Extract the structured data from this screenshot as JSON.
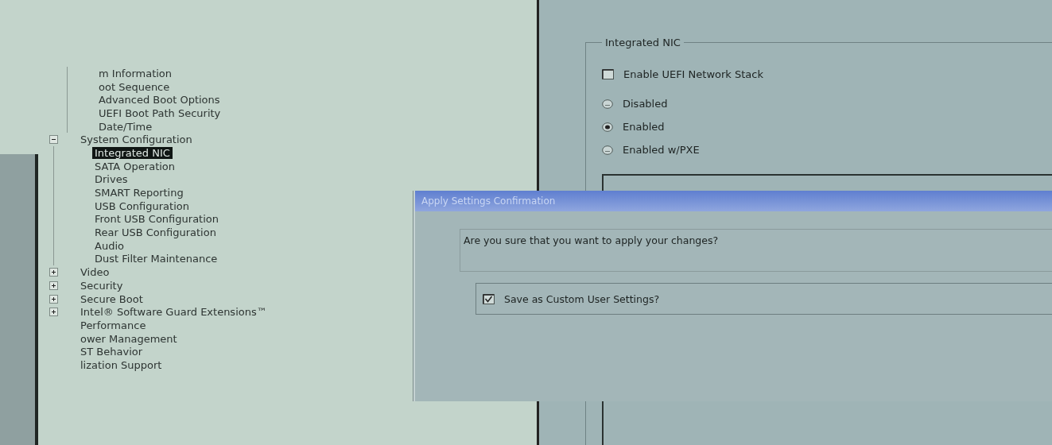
{
  "tree": [
    {
      "children": [
        {
          "label": "m Information",
          "selected": false
        },
        {
          "label": "oot Sequence",
          "selected": false
        },
        {
          "label": "Advanced Boot Options",
          "selected": false
        },
        {
          "label": "UEFI Boot Path Security",
          "selected": false
        },
        {
          "label": "Date/Time",
          "selected": false
        }
      ]
    },
    {
      "label": "System Configuration",
      "selected": false,
      "expanded": true,
      "children": [
        {
          "label": "Integrated NIC",
          "selected": true
        },
        {
          "label": "SATA Operation",
          "selected": false
        },
        {
          "label": "Drives",
          "selected": false
        },
        {
          "label": "SMART Reporting",
          "selected": false
        },
        {
          "label": "USB Configuration",
          "selected": false
        },
        {
          "label": "Front USB Configuration",
          "selected": false
        },
        {
          "label": "Rear USB Configuration",
          "selected": false
        },
        {
          "label": "Audio",
          "selected": false
        },
        {
          "label": "Dust Filter Maintenance",
          "selected": false
        }
      ]
    },
    {
      "label": "Video",
      "selected": false,
      "expanded": false
    },
    {
      "label": "Security",
      "selected": false,
      "expanded": false
    },
    {
      "label": "Secure Boot",
      "selected": false,
      "expanded": false
    },
    {
      "label": "Intel® Software Guard Extensions™",
      "selected": false,
      "expanded": false
    },
    {
      "label": "Performance",
      "selected": false
    },
    {
      "label": "ower Management",
      "selected": false
    },
    {
      "label": "ST Behavior",
      "selected": false
    },
    {
      "label": "lization Support",
      "selected": false
    }
  ],
  "settings": {
    "group_title": "Integrated NIC",
    "checkbox": {
      "label": "Enable UEFI Network Stack",
      "checked": false
    },
    "options": [
      {
        "label": "Disabled",
        "selected": false
      },
      {
        "label": "Enabled",
        "selected": true
      },
      {
        "label": "Enabled w/PXE",
        "selected": false
      }
    ]
  },
  "dialog": {
    "title": "Apply Settings Confirmation",
    "message": "Are you sure that you want to apply your changes?",
    "checkbox": {
      "label": "Save as Custom User Settings?",
      "checked": true
    }
  }
}
